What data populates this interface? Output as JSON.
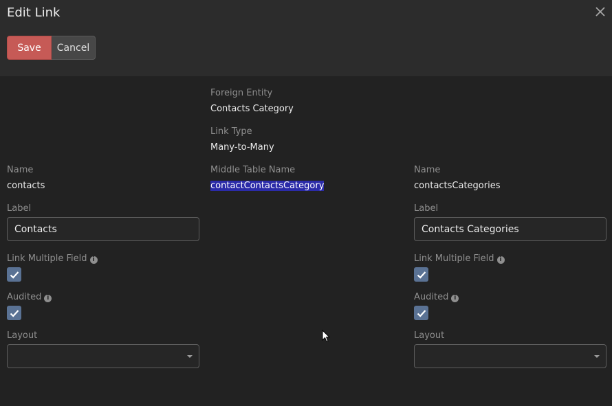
{
  "dialog": {
    "title": "Edit Link"
  },
  "toolbar": {
    "save_label": "Save",
    "cancel_label": "Cancel"
  },
  "center": {
    "foreign_entity_label": "Foreign Entity",
    "foreign_entity_value": "Contacts Category",
    "link_type_label": "Link Type",
    "link_type_value": "Many-to-Many",
    "middle_table_label": "Middle Table Name",
    "middle_table_value": "contactContactsCategory"
  },
  "left": {
    "name_label": "Name",
    "name_value": "contacts",
    "label_label": "Label",
    "label_value": "Contacts",
    "link_multiple_label": "Link Multiple Field",
    "link_multiple_checked": true,
    "audited_label": "Audited",
    "audited_checked": true,
    "layout_label": "Layout",
    "layout_value": ""
  },
  "right": {
    "name_label": "Name",
    "name_value": "contactsCategories",
    "label_label": "Label",
    "label_value": "Contacts Categories",
    "link_multiple_label": "Link Multiple Field",
    "link_multiple_checked": true,
    "audited_label": "Audited",
    "audited_checked": true,
    "layout_label": "Layout",
    "layout_value": ""
  },
  "icons": {
    "close": "close-icon",
    "info": "info-icon",
    "check": "check-icon",
    "caret": "caret-down-icon",
    "cursor": "mouse-pointer-icon"
  },
  "colors": {
    "save_button": "#c65a56",
    "checkbox": "#5a7294",
    "selection": "#2b2ba8",
    "background": "#222222",
    "header": "#2c2c2c"
  }
}
